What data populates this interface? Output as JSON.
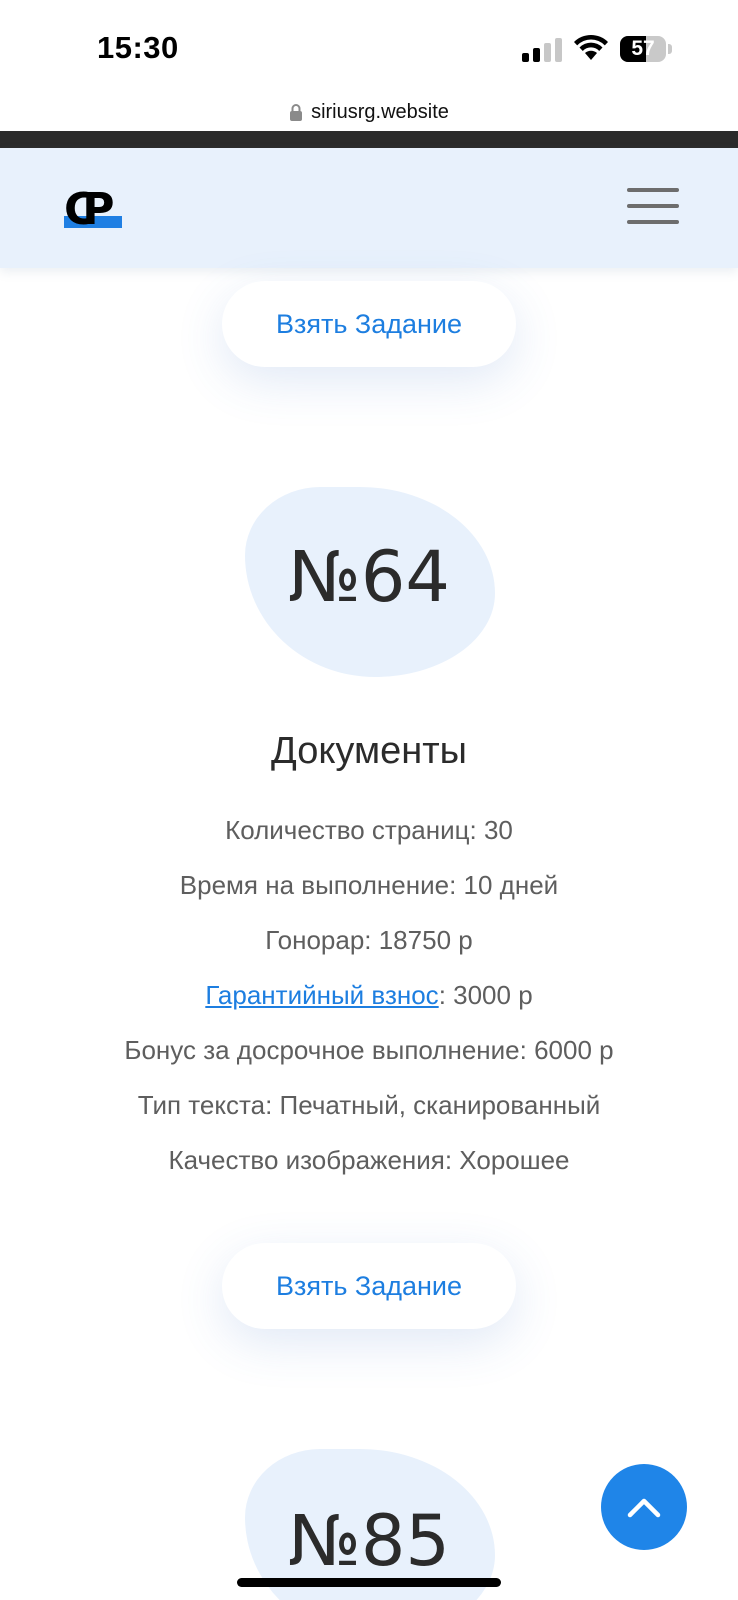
{
  "status_bar": {
    "time": "15:30",
    "battery_level": "57",
    "battery_fraction": 0.57
  },
  "browser": {
    "url": "siriusrg.website"
  },
  "header": {
    "logo_text": "CP",
    "logo_icon": "cp-logo-icon",
    "menu_icon": "hamburger-menu-icon",
    "accent_color": "#1f7fe3"
  },
  "take_task_label": "Взять Задание",
  "tasks": [
    {
      "number": "№64",
      "title": "Документы",
      "pages": "Количество страниц: 30",
      "time": "Время на выполнение: 10 дней",
      "fee": "Гонорар: 18750 р",
      "deposit_link": "Гарантийный взнос",
      "deposit_value": ": 3000 р",
      "bonus": "Бонус за досрочное выполнение: 6000 р",
      "text_type": "Тип текста: Печатный, сканированный",
      "image_quality": "Качество изображения: Хорошее"
    },
    {
      "number": "№85"
    }
  ],
  "scroll_top_icon": "chevron-up-icon",
  "colors": {
    "link": "#1d7ee0",
    "scroll_button": "#1f85e8",
    "header_bg": "#e8f1fc"
  }
}
